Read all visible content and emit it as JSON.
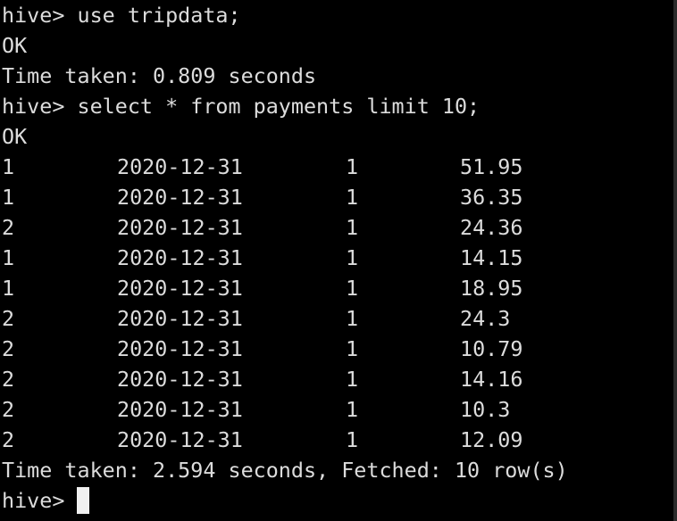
{
  "terminal": {
    "lines_before": [
      "hive> use tripdata;",
      "OK",
      "Time taken: 0.809 seconds",
      "hive> select * from payments limit 10;",
      "OK"
    ],
    "rows": [
      [
        "1",
        "2020-12-31",
        "1",
        "51.95"
      ],
      [
        "1",
        "2020-12-31",
        "1",
        "36.35"
      ],
      [
        "2",
        "2020-12-31",
        "1",
        "24.36"
      ],
      [
        "1",
        "2020-12-31",
        "1",
        "14.15"
      ],
      [
        "1",
        "2020-12-31",
        "1",
        "18.95"
      ],
      [
        "2",
        "2020-12-31",
        "1",
        "24.3"
      ],
      [
        "2",
        "2020-12-31",
        "1",
        "10.79"
      ],
      [
        "2",
        "2020-12-31",
        "1",
        "14.16"
      ],
      [
        "2",
        "2020-12-31",
        "1",
        "10.3"
      ],
      [
        "2",
        "2020-12-31",
        "1",
        "12.09"
      ]
    ],
    "summary": "Time taken: 2.594 seconds, Fetched: 10 row(s)",
    "prompt": "hive>",
    "colors": {
      "background": "#000000",
      "foreground": "#dcdcdc",
      "cursor": "#f0f0f0"
    }
  }
}
